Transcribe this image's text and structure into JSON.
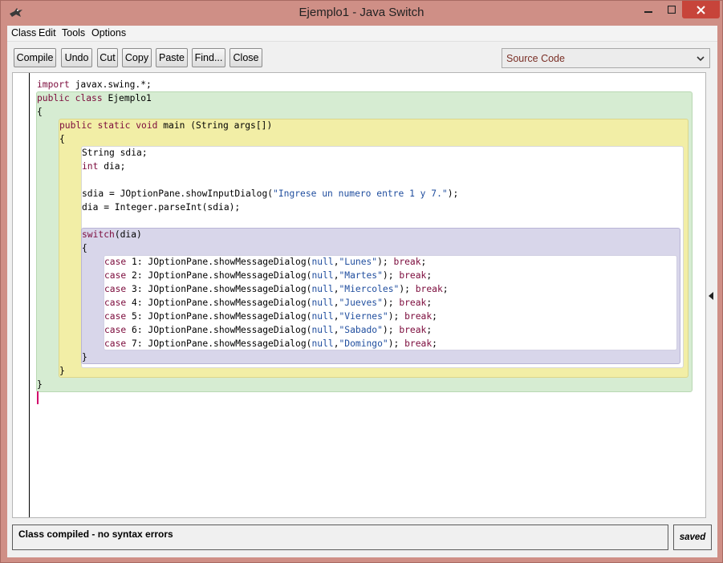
{
  "window": {
    "title": "Ejemplo1 - Java Switch",
    "accent_color": "#cf8f86",
    "close_color": "#c7443a"
  },
  "menu": [
    "Class",
    "Edit",
    "Tools",
    "Options"
  ],
  "toolbar": {
    "buttons": [
      "Compile",
      "Undo",
      "Cut",
      "Copy",
      "Paste",
      "Find...",
      "Close"
    ],
    "view_select": "Source Code"
  },
  "scope_colors": {
    "class": "#d6ecd2",
    "method": "#f2eea6",
    "body": "#ffffff",
    "switch": "#d8d6ea",
    "cases": "#ffffff"
  },
  "code": [
    [
      {
        "t": "import",
        "c": "kw"
      },
      {
        "t": " javax.swing.*;"
      }
    ],
    [
      {
        "t": "public",
        "c": "kw"
      },
      {
        "t": " "
      },
      {
        "t": "class",
        "c": "kw"
      },
      {
        "t": " Ejemplo1"
      }
    ],
    [
      {
        "t": "{"
      }
    ],
    [
      {
        "t": "public static void",
        "c": "kw"
      },
      {
        "t": " main (String args[])"
      }
    ],
    [
      {
        "t": "{"
      }
    ],
    [
      {
        "t": "String sdia;"
      }
    ],
    [
      {
        "t": "int",
        "c": "kw"
      },
      {
        "t": " dia;"
      }
    ],
    [
      {
        "t": ""
      }
    ],
    [
      {
        "t": "sdia = JOptionPane.showInputDialog("
      },
      {
        "t": "\"Ingrese un numero entre 1 y 7.\"",
        "c": "str"
      },
      {
        "t": ");"
      }
    ],
    [
      {
        "t": "dia = Integer.parseInt(sdia);"
      }
    ],
    [
      {
        "t": ""
      }
    ],
    [
      {
        "t": "switch",
        "c": "kw"
      },
      {
        "t": "(dia)"
      }
    ],
    [
      {
        "t": "{"
      }
    ],
    [
      {
        "t": "case",
        "c": "kw"
      },
      {
        "t": " 1: JOptionPane.showMessageDialog("
      },
      {
        "t": "null",
        "c": "nul"
      },
      {
        "t": ","
      },
      {
        "t": "\"Lunes\"",
        "c": "str"
      },
      {
        "t": "); "
      },
      {
        "t": "break",
        "c": "kw"
      },
      {
        "t": ";"
      }
    ],
    [
      {
        "t": "case",
        "c": "kw"
      },
      {
        "t": " 2: JOptionPane.showMessageDialog("
      },
      {
        "t": "null",
        "c": "nul"
      },
      {
        "t": ","
      },
      {
        "t": "\"Martes\"",
        "c": "str"
      },
      {
        "t": "); "
      },
      {
        "t": "break",
        "c": "kw"
      },
      {
        "t": ";"
      }
    ],
    [
      {
        "t": "case",
        "c": "kw"
      },
      {
        "t": " 3: JOptionPane.showMessageDialog("
      },
      {
        "t": "null",
        "c": "nul"
      },
      {
        "t": ","
      },
      {
        "t": "\"Miercoles\"",
        "c": "str"
      },
      {
        "t": "); "
      },
      {
        "t": "break",
        "c": "kw"
      },
      {
        "t": ";"
      }
    ],
    [
      {
        "t": "case",
        "c": "kw"
      },
      {
        "t": " 4: JOptionPane.showMessageDialog("
      },
      {
        "t": "null",
        "c": "nul"
      },
      {
        "t": ","
      },
      {
        "t": "\"Jueves\"",
        "c": "str"
      },
      {
        "t": "); "
      },
      {
        "t": "break",
        "c": "kw"
      },
      {
        "t": ";"
      }
    ],
    [
      {
        "t": "case",
        "c": "kw"
      },
      {
        "t": " 5: JOptionPane.showMessageDialog("
      },
      {
        "t": "null",
        "c": "nul"
      },
      {
        "t": ","
      },
      {
        "t": "\"Viernes\"",
        "c": "str"
      },
      {
        "t": "); "
      },
      {
        "t": "break",
        "c": "kw"
      },
      {
        "t": ";"
      }
    ],
    [
      {
        "t": "case",
        "c": "kw"
      },
      {
        "t": " 6: JOptionPane.showMessageDialog("
      },
      {
        "t": "null",
        "c": "nul"
      },
      {
        "t": ","
      },
      {
        "t": "\"Sabado\"",
        "c": "str"
      },
      {
        "t": "); "
      },
      {
        "t": "break",
        "c": "kw"
      },
      {
        "t": ";"
      }
    ],
    [
      {
        "t": "case",
        "c": "kw"
      },
      {
        "t": " 7: JOptionPane.showMessageDialog("
      },
      {
        "t": "null",
        "c": "nul"
      },
      {
        "t": ","
      },
      {
        "t": "\"Domingo\"",
        "c": "str"
      },
      {
        "t": "); "
      },
      {
        "t": "break",
        "c": "kw"
      },
      {
        "t": ";"
      }
    ],
    [
      {
        "t": "}"
      }
    ],
    [
      {
        "t": "}"
      }
    ],
    [
      {
        "t": "}"
      }
    ]
  ],
  "status": {
    "message": "Class compiled - no syntax errors",
    "saved": "saved"
  }
}
